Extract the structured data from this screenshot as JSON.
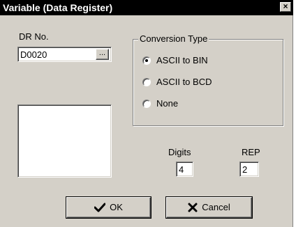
{
  "window": {
    "title": "Variable (Data Register)",
    "close_glyph": "×"
  },
  "dr": {
    "label": "DR No.",
    "value": "D0020",
    "browse_label": "..."
  },
  "conversion": {
    "title": "Conversion Type",
    "options": [
      {
        "label": "ASCII to BIN",
        "selected": true
      },
      {
        "label": "ASCII to BCD",
        "selected": false
      },
      {
        "label": "None",
        "selected": false
      }
    ]
  },
  "digits": {
    "label": "Digits",
    "value": "4"
  },
  "rep": {
    "label": "REP",
    "value": "2"
  },
  "buttons": {
    "ok": {
      "label": "OK",
      "icon": "checkmark-icon",
      "color": "#000000"
    },
    "cancel": {
      "label": "Cancel",
      "icon": "x-icon",
      "color": "#000000"
    }
  }
}
